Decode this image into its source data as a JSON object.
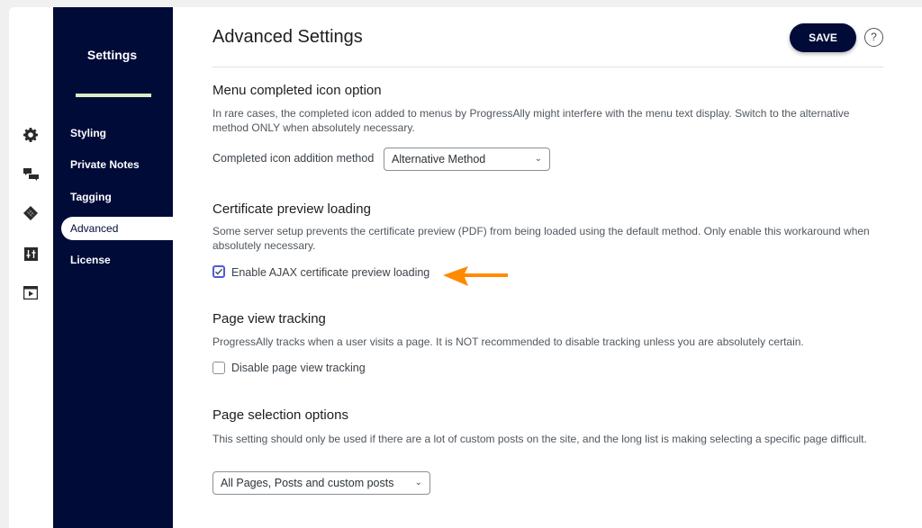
{
  "sidebar": {
    "title": "Settings",
    "accent_color": "#d6f0c4",
    "items": [
      {
        "label": "Styling",
        "active": false
      },
      {
        "label": "Private Notes",
        "active": false
      },
      {
        "label": "Tagging",
        "active": false
      },
      {
        "label": "Advanced",
        "active": true
      },
      {
        "label": "License",
        "active": false
      }
    ]
  },
  "iconbar": {
    "icons": [
      "gear-icon",
      "chat-bubbles-icon",
      "tag-icon",
      "sliders-icon",
      "video-icon"
    ]
  },
  "header": {
    "title": "Advanced Settings",
    "save_label": "SAVE",
    "help_label": "?"
  },
  "sections": {
    "menu_icon": {
      "heading": "Menu completed icon option",
      "description": "In rare cases, the completed icon added to menus by ProgressAlly might interfere with the menu text display. Switch to the alternative method ONLY when absolutely necessary.",
      "field_label": "Completed icon addition method",
      "selected": "Alternative Method"
    },
    "certificate": {
      "heading": "Certificate preview loading",
      "description": "Some server setup prevents the certificate preview (PDF) from being loaded using the default method. Only enable this workaround when absolutely necessary.",
      "checkbox_label": "Enable AJAX certificate preview loading",
      "checked": true
    },
    "tracking": {
      "heading": "Page view tracking",
      "description": "ProgressAlly tracks when a user visits a page. It is NOT recommended to disable tracking unless you are absolutely certain.",
      "checkbox_label": "Disable page view tracking",
      "checked": false
    },
    "page_selection": {
      "heading": "Page selection options",
      "description": "This setting should only be used if there are a lot of custom posts on the site, and the long list is making selecting a specific page difficult.",
      "selected": "All Pages, Posts and custom posts"
    }
  },
  "colors": {
    "brand_navy": "#000b38",
    "annotation_arrow": "#ff8a00",
    "checkbox_accent": "#4f5bd5"
  }
}
